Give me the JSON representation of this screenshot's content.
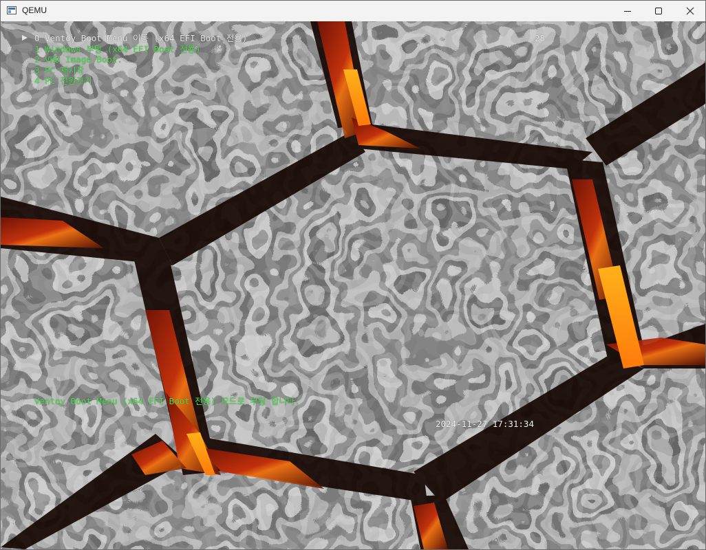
{
  "window": {
    "title": "QEMU",
    "minimize_icon": "minimize-icon",
    "maximize_icon": "maximize-icon",
    "close_icon": "close-icon"
  },
  "boot_menu": {
    "selected_index": 0,
    "items": [
      {
        "label": "0 Ventoy Boot Menu 이동 (x64 EFI Boot 전용)"
      },
      {
        "label": "1 Windows 부팅 (x64 EFI Boot 전용)"
      },
      {
        "label": "2 VHD Image Boot."
      },
      {
        "label": "3 PC 재시작"
      },
      {
        "label": "4 PC 전원끄기"
      }
    ],
    "countdown": "28",
    "status_message": "Ventoy Boot Menu (x64 EFI Boot 전용) 모드로 부팅 합니다.",
    "datetime": "2024-11-27 17:31:34"
  },
  "colors": {
    "selected_text": "#e8e8e8",
    "menu_text": "#4fe04f",
    "status_text": "#4fe04f",
    "countdown_text": "#e8e8e8",
    "clock_text": "#f2f2f2",
    "lava": "#d8380c",
    "lava_bright": "#ffa21a"
  }
}
